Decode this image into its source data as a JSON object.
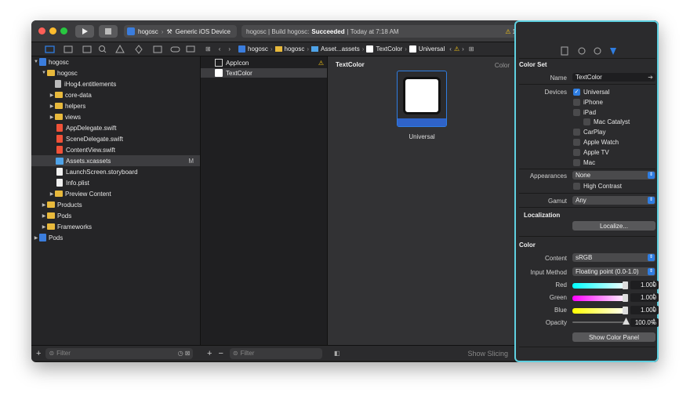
{
  "toolbar": {
    "run_icon": "play-icon",
    "stop_icon": "stop-icon",
    "scheme": "hogosc",
    "destination": "Generic iOS Device",
    "activity_project": "hogosc | Build hogosc:",
    "activity_status": "Succeeded",
    "activity_time": "| Today at 7:18 AM",
    "warning_count": "1",
    "accent": "#5fd0e0"
  },
  "navigator": {
    "items": [
      {
        "label": "hogosc"
      },
      {
        "label": "hogosc"
      },
      {
        "label": "iHog4.entitlements"
      },
      {
        "label": "core-data"
      },
      {
        "label": "helpers"
      },
      {
        "label": "views"
      },
      {
        "label": "AppDelegate.swift"
      },
      {
        "label": "SceneDelegate.swift"
      },
      {
        "label": "ContentView.swift"
      },
      {
        "label": "Assets.xcassets",
        "badge": "M"
      },
      {
        "label": "LaunchScreen.storyboard"
      },
      {
        "label": "Info.plist"
      },
      {
        "label": "Preview Content"
      },
      {
        "label": "Products"
      },
      {
        "label": "Pods"
      },
      {
        "label": "Frameworks"
      },
      {
        "label": "Pods"
      }
    ],
    "filter_placeholder": "Filter"
  },
  "jumpbar": {
    "crumbs": [
      "hogosc",
      "hogosc",
      "Asset...assets",
      "TextColor",
      "Universal"
    ]
  },
  "assets": {
    "items": [
      "AppIcon",
      "TextColor"
    ],
    "filter_placeholder": "Filter"
  },
  "editor": {
    "title": "TextColor",
    "kind": "Color",
    "swatch_label": "Universal",
    "show_slicing": "Show Slicing"
  },
  "inspector": {
    "color_set_header": "Color Set",
    "name_label": "Name",
    "name_value": "TextColor",
    "devices_label": "Devices",
    "devices": [
      {
        "label": "Universal",
        "checked": true
      },
      {
        "label": "iPhone",
        "checked": false
      },
      {
        "label": "iPad",
        "checked": false
      },
      {
        "label": "Mac Catalyst",
        "checked": false
      },
      {
        "label": "CarPlay",
        "checked": false
      },
      {
        "label": "Apple Watch",
        "checked": false
      },
      {
        "label": "Apple TV",
        "checked": false
      },
      {
        "label": "Mac",
        "checked": false
      }
    ],
    "appearances_label": "Appearances",
    "appearances_value": "None",
    "high_contrast": "High Contrast",
    "gamut_label": "Gamut",
    "gamut_value": "Any",
    "localization_header": "Localization",
    "localize_button": "Localize...",
    "color_header": "Color",
    "content_label": "Content",
    "content_value": "sRGB",
    "input_method_label": "Input Method",
    "input_method_value": "Floating point (0.0-1.0)",
    "red_label": "Red",
    "red_value": "1.000",
    "green_label": "Green",
    "green_value": "1.000",
    "blue_label": "Blue",
    "blue_value": "1.000",
    "opacity_label": "Opacity",
    "opacity_value": "100.0%",
    "show_color_panel": "Show Color Panel"
  }
}
